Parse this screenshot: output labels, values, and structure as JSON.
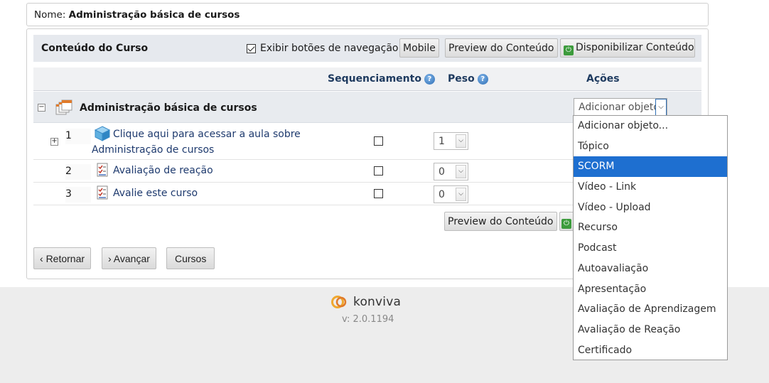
{
  "name_box": {
    "label": "Nome:",
    "value": "Administração básica de cursos"
  },
  "toolbar": {
    "title": "Conteúdo do Curso",
    "nav_checkbox_label": "Exibir botões de navegação",
    "nav_checkbox_checked": true,
    "mobile_label": "Mobile",
    "preview_label": "Preview do Conteúdo",
    "publish_label": "Disponibilizar Conteúdo"
  },
  "table": {
    "headers": {
      "sequencing": "Sequenciamento",
      "weight": "Peso",
      "actions": "Ações"
    },
    "course_title": "Administração básica de cursos",
    "action_select_value": "Adicionar objeto...",
    "items": [
      {
        "index": "1",
        "title_line1": "Clique aqui para acessar a aula sobre",
        "title_line2": "Administração de cursos",
        "weight": "1",
        "sequenced": false,
        "icon": "scorm-cube-icon"
      },
      {
        "index": "2",
        "title": "Avaliação de reação",
        "weight": "0",
        "sequenced": false,
        "icon": "checklist-icon"
      },
      {
        "index": "3",
        "title": "Avalie este curso",
        "weight": "0",
        "sequenced": false,
        "icon": "checklist-icon"
      }
    ],
    "bottom_preview_label": "Preview do Conteúdo"
  },
  "nav_buttons": {
    "back": "Retornar",
    "next": "Avançar",
    "courses": "Cursos"
  },
  "footer": {
    "logo_text": "konviva",
    "version": "v: 2.0.1194"
  },
  "dropdown": {
    "selected_index": 2,
    "options": [
      "Adicionar objeto...",
      "Tópico",
      "SCORM",
      "Vídeo - Link",
      "Vídeo - Upload",
      "Recurso",
      "Podcast",
      "Autoavaliação",
      "Apresentação",
      "Avaliação de Aprendizagem",
      "Avaliação de Reação",
      "Certificado"
    ]
  },
  "colors": {
    "accent": "#1e6fd0",
    "link": "#1e3a6e",
    "header_text": "#1e3a5f",
    "power_green": "#3c9b3c"
  }
}
